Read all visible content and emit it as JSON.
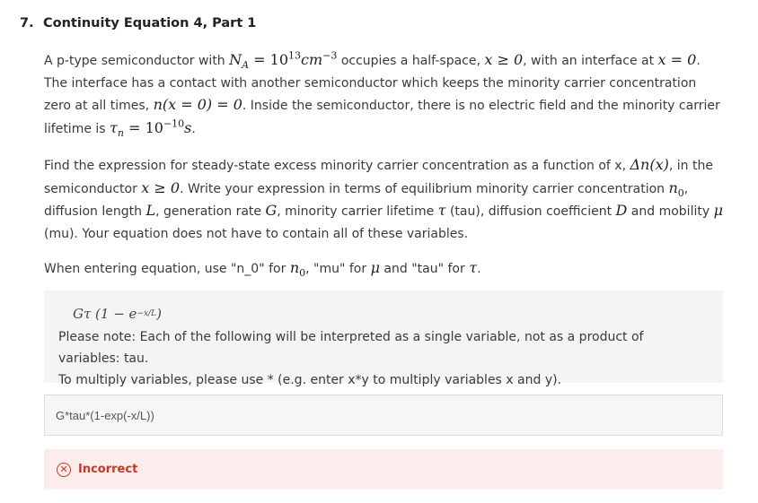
{
  "question": {
    "number": "7.",
    "title": "Continuity Equation 4, Part 1"
  },
  "paragraph1": {
    "t1": "A p-type semiconductor with ",
    "na_sym": "N",
    "na_sub": "A",
    "na_eq": " = 10",
    "na_exp": "13",
    "na_unit": "cm",
    "na_unit_exp": "−3",
    "t2": " occupies a half-space, ",
    "half_space": "x ≥ 0",
    "t3": ", with an interface at ",
    "interface": "x = 0",
    "t4": ". The interface has a contact with another semiconductor which keeps the minority carrier concentration zero at all times, ",
    "bc": "n(x = 0) = 0",
    "t5": ". Inside the semiconductor, there is no electric field and the minority carrier lifetime is ",
    "tau_sym": "τ",
    "tau_sub": "n",
    "tau_eq": " = 10",
    "tau_exp": "−10",
    "tau_unit": "s",
    "t6": "."
  },
  "paragraph2": {
    "t1": "Find the expression for steady-state excess minority carrier concentration as a function of x, ",
    "dn": "Δn(x)",
    "t2": ", in the semiconductor ",
    "domain": "x ≥ 0",
    "t3": ". Write your expression in terms of equilibrium minority carrier concentration ",
    "n0": "n",
    "n0_sub": "0",
    "t4": ", diffusion length ",
    "L": "L",
    "t5": ", generation rate ",
    "G": "G",
    "t6": ", minority carrier lifetime ",
    "tau": "τ",
    "t7": " (tau), diffusion coefficient ",
    "D": "D",
    "t8": " and mobility ",
    "mu": "μ",
    "t9": " (mu). Your equation does not have to contain all of these variables."
  },
  "paragraph3": {
    "t1": "When entering equation, use \"n_0\" for ",
    "n0": "n",
    "n0_sub": "0",
    "t2": ", \"mu\" for ",
    "mu": "μ",
    "t3": " and \"tau\" for ",
    "tau": "τ",
    "t4": "."
  },
  "hint": {
    "formula_main": "Gτ (1 − e",
    "formula_exp": "−x/L",
    "formula_close": ")",
    "note_line1": "Please note: Each of the following will be interpreted as a single variable, not as a product of variables: tau.",
    "note_line2": "To multiply variables, please use * (e.g. enter x*y to multiply variables x and y)."
  },
  "answer_input": {
    "value": "G*tau*(1-exp(-x/L))"
  },
  "status": {
    "label": "Incorrect",
    "icon": "x-circle-icon",
    "color": "#c0392b"
  }
}
